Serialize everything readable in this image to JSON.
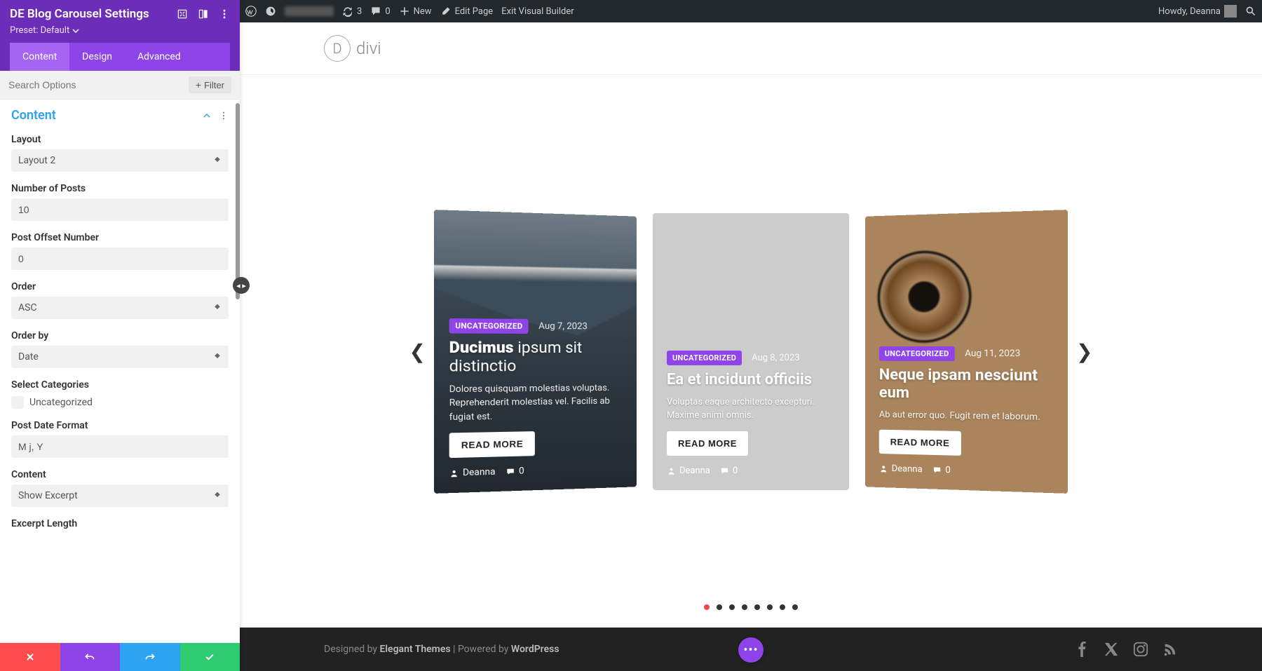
{
  "wpbar": {
    "refresh_count": "3",
    "comments_count": "0",
    "new_label": "New",
    "edit_page_label": "Edit Page",
    "exit_vb_label": "Exit Visual Builder",
    "howdy_label": "Howdy, Deanna"
  },
  "panel": {
    "title": "DE Blog Carousel Settings",
    "preset_label": "Preset: Default",
    "tabs": {
      "content": "Content",
      "design": "Design",
      "advanced": "Advanced"
    },
    "search_placeholder": "Search Options",
    "filter_label": "Filter",
    "section_title": "Content",
    "fields": {
      "layout": {
        "label": "Layout",
        "value": "Layout 2"
      },
      "num_posts": {
        "label": "Number of Posts",
        "value": "10"
      },
      "offset": {
        "label": "Post Offset Number",
        "value": "0"
      },
      "order": {
        "label": "Order",
        "value": "ASC"
      },
      "orderby": {
        "label": "Order by",
        "value": "Date"
      },
      "categories": {
        "label": "Select Categories",
        "option": "Uncategorized"
      },
      "date_format": {
        "label": "Post Date Format",
        "value": "M j, Y"
      },
      "content": {
        "label": "Content",
        "value": "Show Excerpt"
      },
      "excerpt_len": {
        "label": "Excerpt Length"
      }
    }
  },
  "site": {
    "logo_text": "divi",
    "logo_d": "D"
  },
  "cards": [
    {
      "category": "UNCATEGORIZED",
      "date": "Aug 7, 2023",
      "title_strong": "Ducimus",
      "title_rest": " ipsum sit distinctio",
      "excerpt": "Dolores quisquam molestias voluptas. Reprehenderit molestias vel. Facilis ab fugiat est.",
      "read_more": "READ MORE",
      "author": "Deanna",
      "comments": "0"
    },
    {
      "category": "UNCATEGORIZED",
      "date": "Aug 8, 2023",
      "title_strong": "Ea et incidunt officiis",
      "title_rest": "",
      "excerpt": "Voluptas eaque architecto excepturi. Maxime animi omnis.",
      "read_more": "READ MORE",
      "author": "Deanna",
      "comments": "0"
    },
    {
      "category": "UNCATEGORIZED",
      "date": "Aug 11, 2023",
      "title_strong": "Neque ipsam nesciunt eum",
      "title_rest": "",
      "excerpt": "Ab aut error quo. Fugit rem et laborum.",
      "read_more": "READ MORE",
      "author": "Deanna",
      "comments": "0"
    }
  ],
  "footer": {
    "designed_by_prefix": "Designed by ",
    "designed_by_link": "Elegant Themes",
    "powered_sep": " | Powered by ",
    "powered_link": "WordPress"
  }
}
